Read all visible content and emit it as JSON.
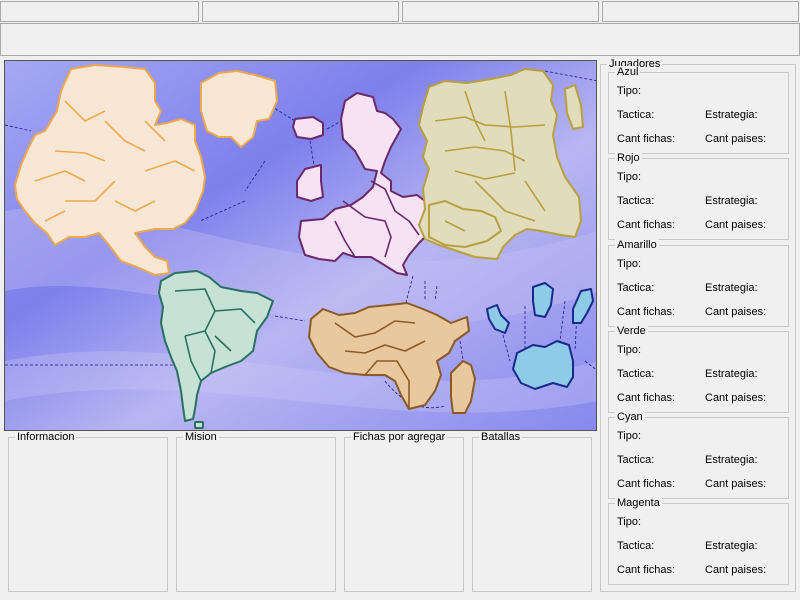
{
  "toolbar_tabs": [
    "",
    "",
    "",
    ""
  ],
  "panels": {
    "informacion": "Informacion",
    "mision": "Mision",
    "fichas": "Fichas por agregar",
    "batallas": "Batallas"
  },
  "players_group": {
    "title": "Jugadores",
    "labels": {
      "tipo": "Tipo:",
      "tactica": "Tactica:",
      "estrategia": "Estrategia:",
      "cant_fichas": "Cant fichas:",
      "cant_paises": "Cant paises:"
    },
    "players": [
      {
        "name": "Azul"
      },
      {
        "name": "Rojo"
      },
      {
        "name": "Amarillo"
      },
      {
        "name": "Verde"
      },
      {
        "name": "Cyan"
      },
      {
        "name": "Magenta"
      }
    ]
  },
  "map": {
    "continents": [
      {
        "name": "north-america",
        "fill": "#f9e7d6",
        "stroke": "#f0a850"
      },
      {
        "name": "south-america",
        "fill": "#c6e2d6",
        "stroke": "#2a7060"
      },
      {
        "name": "europe",
        "fill": "#f6e2f4",
        "stroke": "#6a2a6a"
      },
      {
        "name": "asia",
        "fill": "#e0dcbc",
        "stroke": "#b8a040"
      },
      {
        "name": "africa",
        "fill": "#e8c89c",
        "stroke": "#8a5a28"
      },
      {
        "name": "oceania",
        "fill": "#8ecbe6",
        "stroke": "#1a2a8a"
      }
    ],
    "ocean_color": "#8c8ef0"
  }
}
